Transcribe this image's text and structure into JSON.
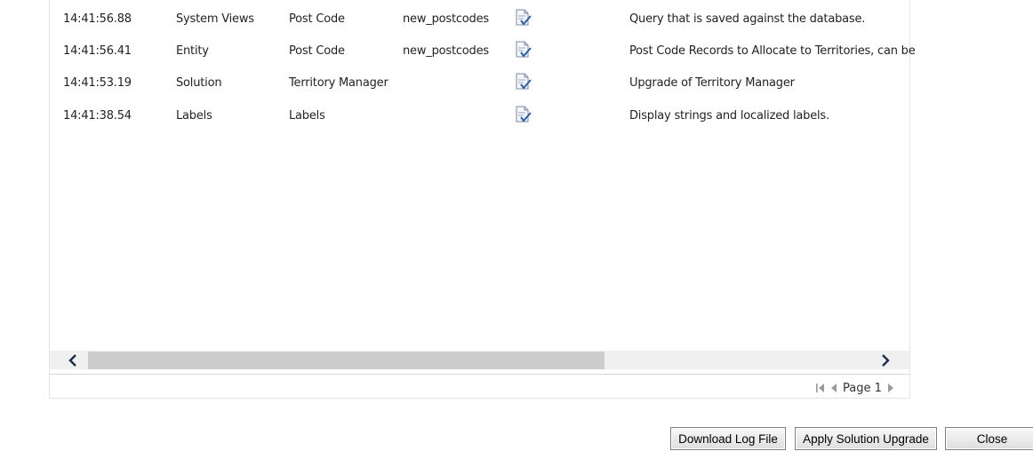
{
  "table": {
    "rows": [
      {
        "time": "14:41:56.88",
        "type": "System Views",
        "name": "Post Code",
        "schema": "new_postcodes",
        "status_icon": "success-check-icon",
        "description": "Query that is saved against the database."
      },
      {
        "time": "14:41:56.41",
        "type": "Entity",
        "name": "Post Code",
        "schema": "new_postcodes",
        "status_icon": "success-check-icon",
        "description": "Post Code Records to Allocate to Territories, can be"
      },
      {
        "time": "14:41:53.19",
        "type": "Solution",
        "name": "Territory Manager",
        "schema": "",
        "status_icon": "success-check-icon",
        "description": "Upgrade of Territory Manager"
      },
      {
        "time": "14:41:38.54",
        "type": "Labels",
        "name": "Labels",
        "schema": "",
        "status_icon": "success-check-icon",
        "description": "Display strings and localized labels."
      }
    ]
  },
  "pager": {
    "label": "Page 1"
  },
  "buttons": {
    "download_log": "Download Log File",
    "apply_upgrade": "Apply Solution Upgrade",
    "close": "Close"
  }
}
